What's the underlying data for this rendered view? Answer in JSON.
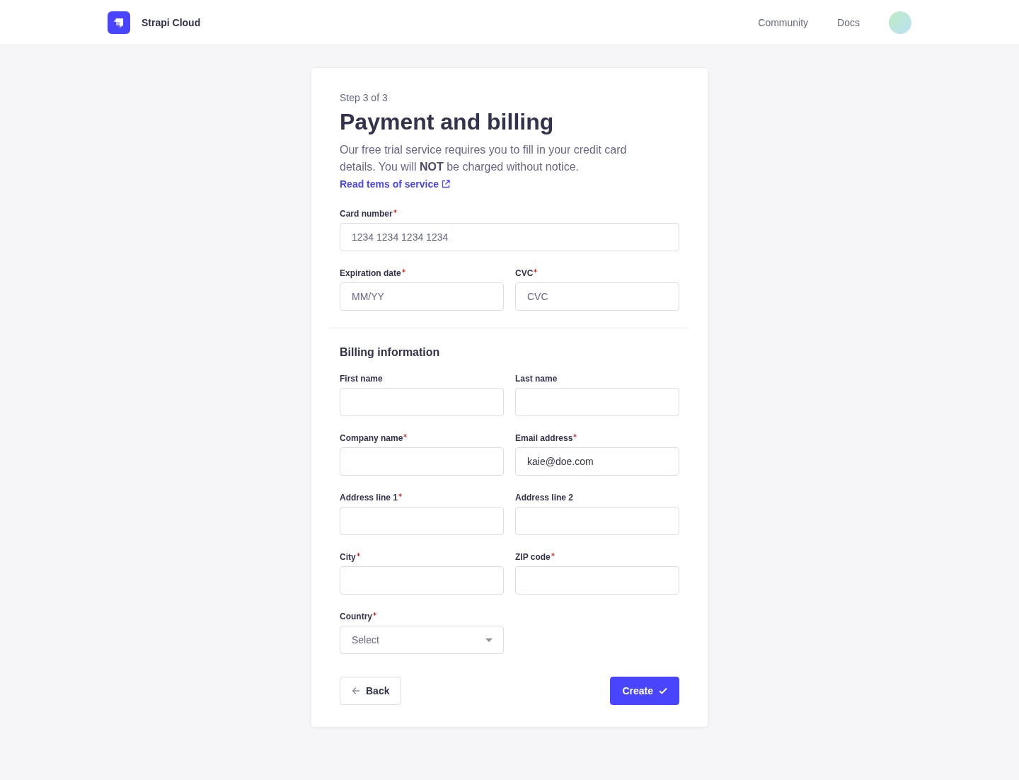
{
  "header": {
    "brand": "Strapi Cloud",
    "nav_links": [
      {
        "label": "Community"
      },
      {
        "label": "Docs"
      }
    ]
  },
  "form": {
    "step": "Step 3 of 3",
    "title": "Payment and billing",
    "intro": "Our free trial service requires you to fill in your credit card details. You will **NOT** be charged without notice.",
    "terms_link": "Read tems of service",
    "payment_fields": [
      {
        "kind": "card_number",
        "label": "Card number",
        "required": true,
        "placeholder": "1234 1234 1234 1234"
      },
      {
        "kind": "text",
        "label": "Expiration date",
        "required": true,
        "placeholder": "MM/YY"
      },
      {
        "kind": "text",
        "label": "CVC",
        "required": true,
        "placeholder": "CVC"
      }
    ],
    "billing_title": "Billing information",
    "billing_fields": [
      {
        "kind": "text",
        "label": "First name",
        "required": false
      },
      {
        "kind": "text",
        "label": "Last name",
        "required": false
      },
      {
        "kind": "text",
        "label": "Company name",
        "required": true
      },
      {
        "kind": "text",
        "label": "Email address",
        "required": true,
        "value": "kaie@doe.com"
      },
      {
        "kind": "text",
        "label": "Address line 1",
        "required": true
      },
      {
        "kind": "text",
        "label": "Address line 2",
        "required": false
      },
      {
        "kind": "text",
        "label": "City",
        "required": true
      },
      {
        "kind": "text",
        "label": "ZIP code",
        "required": true
      },
      {
        "kind": "select",
        "label": "Country",
        "required": true,
        "placeholder": "Select"
      }
    ],
    "buttons": [
      {
        "kind": "back",
        "label": "Back"
      },
      {
        "kind": "submit",
        "label": "Create"
      }
    ]
  }
}
